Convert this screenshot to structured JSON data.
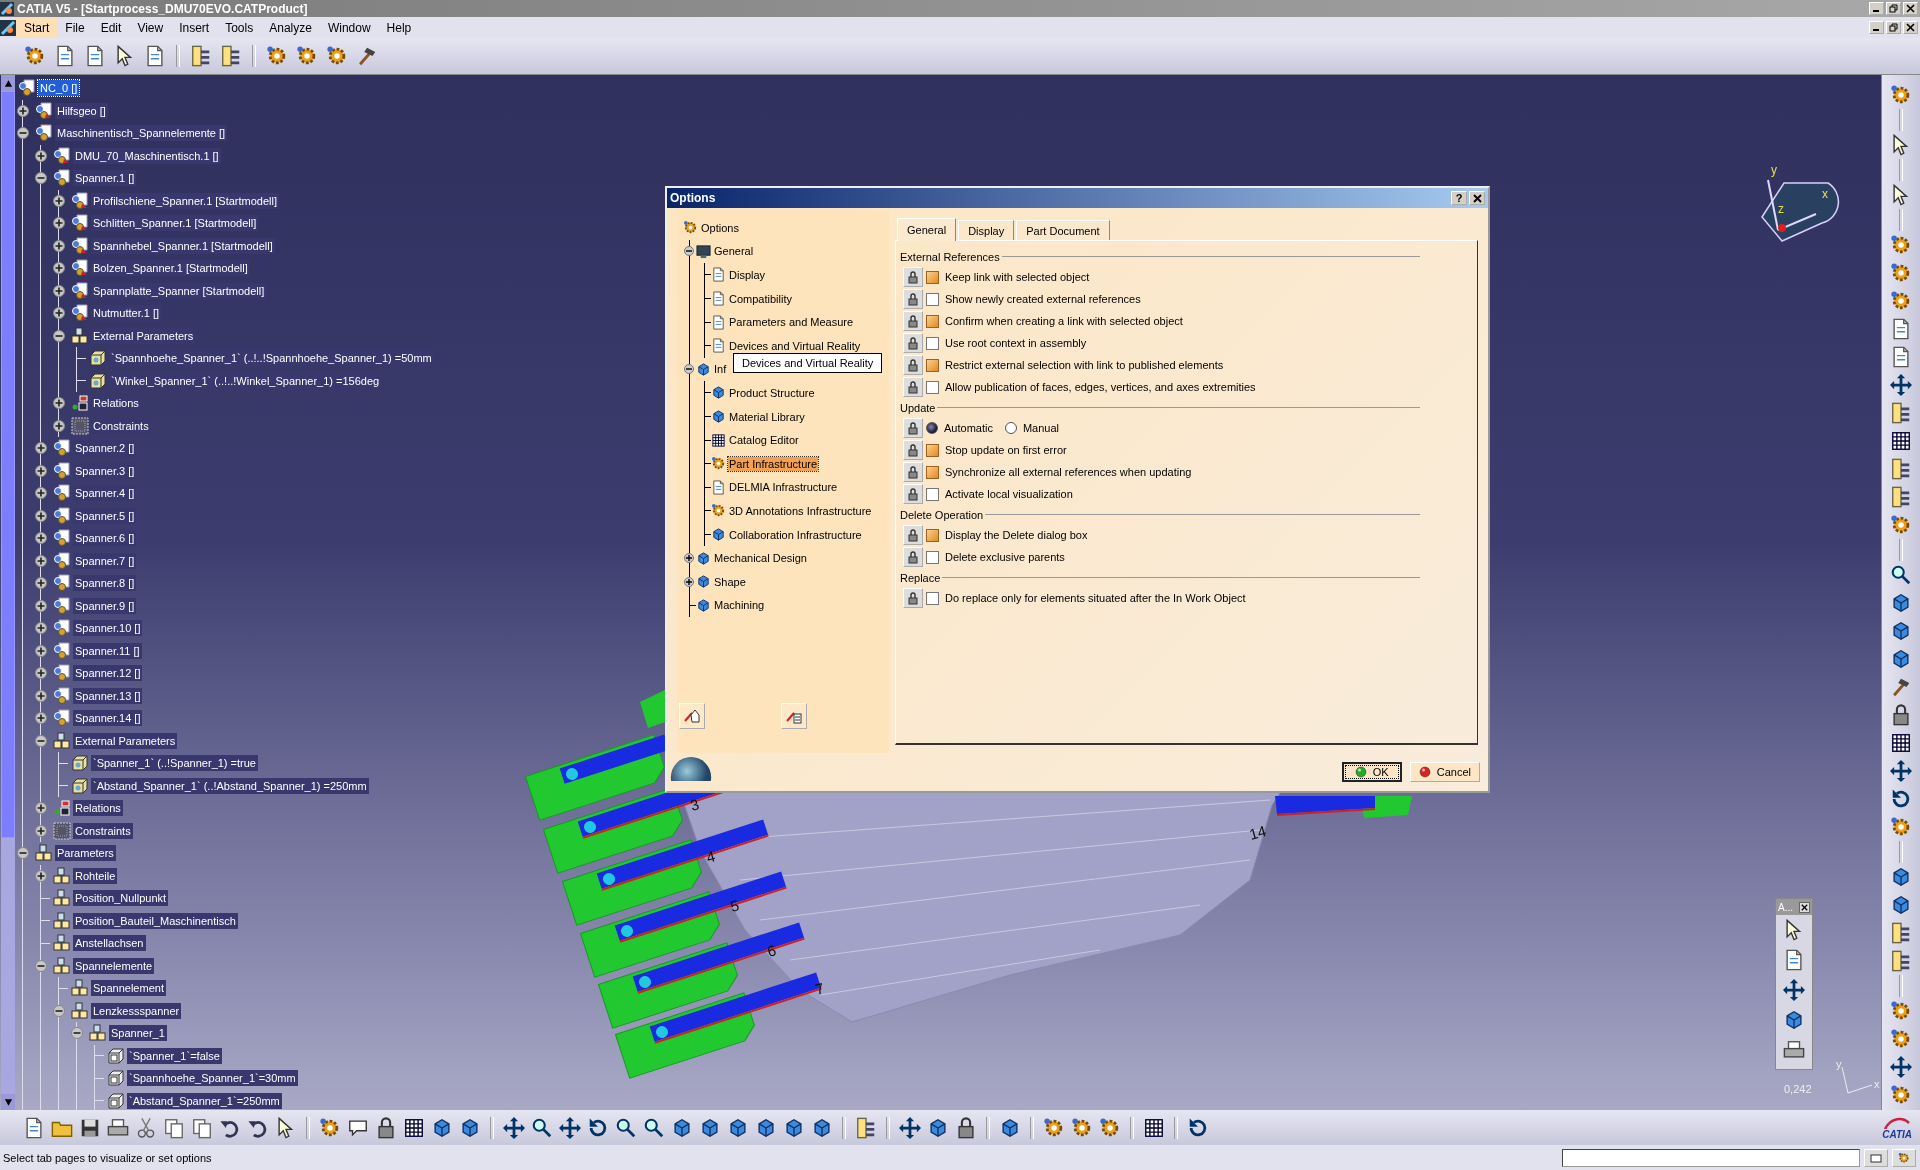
{
  "window": {
    "title": "CATIA V5 - [Startprocess_DMU70EVO.CATProduct]"
  },
  "menu": [
    {
      "label": "Start",
      "selected": true
    },
    {
      "label": "File",
      "selected": false
    },
    {
      "label": "Edit",
      "selected": false
    },
    {
      "label": "View",
      "selected": false
    },
    {
      "label": "Insert",
      "selected": false
    },
    {
      "label": "Tools",
      "selected": false
    },
    {
      "label": "Analyze",
      "selected": false
    },
    {
      "label": "Window",
      "selected": false
    },
    {
      "label": "Help",
      "selected": false
    }
  ],
  "spec_tree": [
    {
      "label": "NC_0 []",
      "kind": "product",
      "selected": true,
      "children": [
        {
          "label": "Hilfsgeo []",
          "kind": "part",
          "expanded": false,
          "selected": false
        },
        {
          "label": "Maschinentisch_Spannelemente []",
          "kind": "product",
          "expanded": true,
          "selected": false,
          "children": [
            {
              "label": "DMU_70_Maschinentisch.1 []",
              "kind": "part",
              "expanded": false,
              "selected": false
            },
            {
              "label": "Spanner.1 []",
              "kind": "product",
              "expanded": true,
              "selected": false,
              "children": [
                {
                  "label": "Profilschiene_Spanner.1 [Startmodell]",
                  "kind": "part",
                  "expanded": false,
                  "selected": false
                },
                {
                  "label": "Schlitten_Spanner.1 [Startmodell]",
                  "kind": "part",
                  "expanded": false,
                  "selected": false
                },
                {
                  "label": "Spannhebel_Spanner.1 [Startmodell]",
                  "kind": "part",
                  "expanded": false,
                  "selected": false
                },
                {
                  "label": "Bolzen_Spanner.1 [Startmodell]",
                  "kind": "part",
                  "expanded": false,
                  "selected": false
                },
                {
                  "label": "Spannplatte_Spanner [Startmodell]",
                  "kind": "part",
                  "expanded": false,
                  "selected": false
                },
                {
                  "label": "Nutmutter.1 []",
                  "kind": "part",
                  "expanded": false,
                  "selected": false
                },
                {
                  "label": "External Parameters",
                  "kind": "params",
                  "expanded": true,
                  "selected": false,
                  "children": [
                    {
                      "label": "`Spannhoehe_Spanner_1` (..!..!Spannhoehe_Spanner_1) =50mm",
                      "kind": "param",
                      "selected": false
                    },
                    {
                      "label": "`Winkel_Spanner_1` (..!..!Winkel_Spanner_1) =156deg",
                      "kind": "param",
                      "selected": false
                    }
                  ]
                },
                {
                  "label": "Relations",
                  "kind": "relations",
                  "expanded": false,
                  "selected": false
                },
                {
                  "label": "Constraints",
                  "kind": "constraints",
                  "expanded": false,
                  "selected": false
                }
              ]
            },
            {
              "label": "Spanner.2 []",
              "kind": "product",
              "expanded": false,
              "selected": false
            },
            {
              "label": "Spanner.3 []",
              "kind": "product",
              "expanded": false,
              "selected": false
            },
            {
              "label": "Spanner.4 []",
              "kind": "product",
              "expanded": false,
              "selected": false
            },
            {
              "label": "Spanner.5 []",
              "kind": "product",
              "expanded": false,
              "selected": false
            },
            {
              "label": "Spanner.6 []",
              "kind": "product",
              "expanded": false,
              "selected": false
            },
            {
              "label": "Spanner.7 []",
              "kind": "product",
              "expanded": false,
              "selected": false
            },
            {
              "label": "Spanner.8 []",
              "kind": "product",
              "expanded": false,
              "selected": false
            },
            {
              "label": "Spanner.9 []",
              "kind": "product",
              "expanded": false,
              "selected": false
            },
            {
              "label": "Spanner.10 []",
              "kind": "product",
              "expanded": false,
              "selected": false
            },
            {
              "label": "Spanner.11 []",
              "kind": "product",
              "expanded": false,
              "selected": false
            },
            {
              "label": "Spanner.12 []",
              "kind": "product",
              "expanded": false,
              "selected": false
            },
            {
              "label": "Spanner.13 []",
              "kind": "product",
              "expanded": false,
              "selected": false
            },
            {
              "label": "Spanner.14 []",
              "kind": "product",
              "expanded": false,
              "selected": false
            },
            {
              "label": "External Parameters",
              "kind": "params",
              "expanded": true,
              "selected": false,
              "children": [
                {
                  "label": "`Spanner_1` (..!Spanner_1) =true",
                  "kind": "param",
                  "selected": false
                },
                {
                  "label": "`Abstand_Spanner_1` (..!Abstand_Spanner_1) =250mm",
                  "kind": "param",
                  "selected": false
                }
              ]
            },
            {
              "label": "Relations",
              "kind": "relations",
              "expanded": false,
              "selected": false
            },
            {
              "label": "Constraints",
              "kind": "constraints",
              "expanded": false,
              "selected": false
            }
          ]
        },
        {
          "label": "Parameters",
          "kind": "params",
          "expanded": true,
          "selected": false,
          "children": [
            {
              "label": "Rohteile",
              "kind": "params",
              "expanded": false,
              "selected": false
            },
            {
              "label": "Position_Nullpunkt",
              "kind": "params",
              "selected": false
            },
            {
              "label": "Position_Bauteil_Maschinentisch",
              "kind": "params",
              "selected": false
            },
            {
              "label": "Anstellachsen",
              "kind": "params",
              "selected": false
            },
            {
              "label": "Spannelemente",
              "kind": "params",
              "expanded": true,
              "selected": false,
              "children": [
                {
                  "label": "Spannelement",
                  "kind": "params",
                  "selected": false
                },
                {
                  "label": "Lenzkessspanner",
                  "kind": "params",
                  "expanded": true,
                  "selected": false,
                  "children": [
                    {
                      "label": "Spanner_1",
                      "kind": "params",
                      "expanded": true,
                      "selected": false,
                      "children": [
                        {
                          "label": "`Spanner_1`=false",
                          "kind": "value",
                          "selected": false
                        },
                        {
                          "label": "`Spannhoehe_Spanner_1`=30mm",
                          "kind": "value",
                          "selected": false
                        },
                        {
                          "label": "`Abstand_Spanner_1`=250mm",
                          "kind": "value",
                          "selected": false
                        }
                      ]
                    }
                  ]
                }
              ]
            }
          ]
        }
      ]
    }
  ],
  "model": {
    "labels": [
      "3",
      "4",
      "5",
      "6",
      "7",
      "14"
    ]
  },
  "compass": {
    "labels": [
      "y",
      "x",
      "z"
    ]
  },
  "options_dialog": {
    "title": "Options",
    "help": "?",
    "tree": [
      {
        "label": "Options",
        "selected": false,
        "children": [
          {
            "label": "General",
            "expanded": true,
            "selected": false,
            "children": [
              {
                "label": "Display",
                "selected": false
              },
              {
                "label": "Compatibility",
                "selected": false
              },
              {
                "label": "Parameters and Measure",
                "selected": false
              },
              {
                "label": "Devices and Virtual Reality",
                "selected": false
              }
            ]
          },
          {
            "label": "Inf",
            "expanded": true,
            "selected": false,
            "children": [
              {
                "label": "Product Structure",
                "selected": false
              },
              {
                "label": "Material Library",
                "selected": false
              },
              {
                "label": "Catalog Editor",
                "selected": false
              },
              {
                "label": "Part Infrastructure",
                "selected": true
              },
              {
                "label": "DELMIA Infrastructure",
                "selected": false
              },
              {
                "label": "3D Annotations Infrastructure",
                "selected": false
              },
              {
                "label": "Collaboration Infrastructure",
                "selected": false
              }
            ]
          },
          {
            "label": "Mechanical Design",
            "expanded": false,
            "selected": false
          },
          {
            "label": "Shape",
            "expanded": false,
            "selected": false
          },
          {
            "label": "Machining",
            "selected": false
          }
        ]
      }
    ],
    "tooltip": "Devices and Virtual Reality",
    "tabs": [
      {
        "label": "General",
        "selected": true
      },
      {
        "label": "Display",
        "selected": false
      },
      {
        "label": "Part Document",
        "selected": false
      }
    ],
    "sections": [
      {
        "title": "External References",
        "rows": [
          {
            "kind": "checkbox",
            "label": "Keep link with selected object",
            "checked": true
          },
          {
            "kind": "checkbox",
            "label": "Show newly created external references",
            "checked": false
          },
          {
            "kind": "checkbox",
            "label": "Confirm when creating a link with selected object",
            "checked": true
          },
          {
            "kind": "checkbox",
            "label": "Use root context in assembly",
            "checked": false
          },
          {
            "kind": "checkbox",
            "label": "Restrict external selection with link to published elements",
            "checked": true
          },
          {
            "kind": "checkbox",
            "label": "Allow publication of faces, edges, vertices, and axes extremities",
            "checked": false
          }
        ]
      },
      {
        "title": "Update",
        "rows": [
          {
            "kind": "radio",
            "options": [
              {
                "label": "Automatic",
                "selected": true
              },
              {
                "label": "Manual",
                "selected": false
              }
            ]
          },
          {
            "kind": "checkbox",
            "label": "Stop update on first error",
            "checked": true
          },
          {
            "kind": "checkbox",
            "label": "Synchronize all external references when updating",
            "checked": true
          },
          {
            "kind": "checkbox",
            "label": "Activate local visualization",
            "checked": false
          }
        ]
      },
      {
        "title": "Delete Operation",
        "rows": [
          {
            "kind": "checkbox",
            "label": "Display the Delete dialog box",
            "checked": true
          },
          {
            "kind": "checkbox",
            "label": "Delete exclusive parents",
            "checked": false
          }
        ]
      },
      {
        "title": "Replace",
        "rows": [
          {
            "kind": "checkbox",
            "label": "Do replace only for elements situated after the In Work Object",
            "checked": false
          }
        ]
      }
    ],
    "buttons": [
      {
        "label": "OK",
        "kind": "ok"
      },
      {
        "label": "Cancel",
        "kind": "cancel"
      }
    ]
  },
  "mini_toolbar": {
    "title": "A..."
  },
  "axis_labels": [
    "y",
    "x"
  ],
  "scale_reading": "0,242",
  "status_bar": {
    "message": "Select tab pages to visualize or set options"
  },
  "logo": "CATIA"
}
